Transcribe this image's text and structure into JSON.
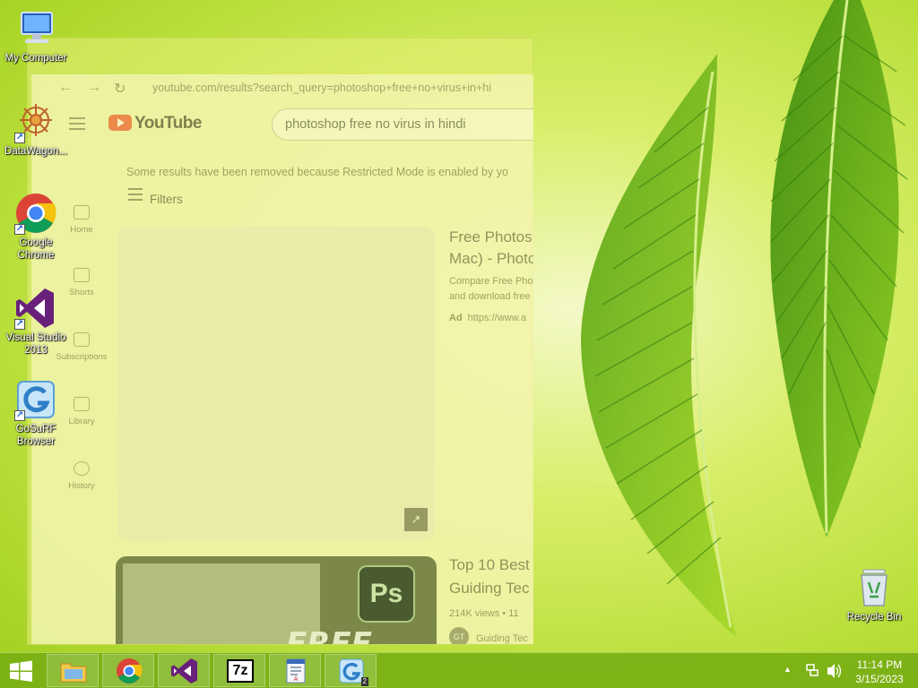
{
  "desktop": {
    "icons": [
      {
        "label": "My Computer"
      },
      {
        "label": "DataWagon..."
      },
      {
        "label": "Google Chrome"
      },
      {
        "label": "Visual Studio 2013"
      },
      {
        "label": "GoSuRF Browser"
      }
    ],
    "recycle_bin": {
      "label": "Recycle Bin"
    }
  },
  "browser": {
    "url": "youtube.com/results?search_query=photoshop+free+no+virus+in+hi",
    "logo": "YouTube",
    "search_value": "photoshop free no virus in hindi",
    "notice": "Some results have been removed because Restricted Mode is enabled by yo",
    "filters_label": "Filters",
    "sidebar": [
      {
        "label": "Home"
      },
      {
        "label": "Shorts"
      },
      {
        "label": "Subscriptions"
      },
      {
        "label": "Library"
      },
      {
        "label": "History"
      }
    ],
    "results": [
      {
        "title_line1": "Free Photos",
        "title_line2": "Mac) - Photo",
        "desc_line1": "Compare Free Pho",
        "desc_line2": "and download free",
        "ad_label": "Ad",
        "ad_url": "https://www.a"
      },
      {
        "title_line1": "Top 10 Best",
        "title_line2": "Guiding Tec",
        "meta": "214K views • 11",
        "channel": "Guiding Tec",
        "channel_initials": "GT",
        "thumb_badge": "Ps",
        "thumb_text": "FREE"
      }
    ]
  },
  "taskbar": {
    "apps": [
      {
        "name": "File Explorer"
      },
      {
        "name": "Google Chrome"
      },
      {
        "name": "Visual Studio"
      },
      {
        "name": "7-Zip",
        "glyph": "7z"
      },
      {
        "name": "Document Viewer"
      },
      {
        "name": "GoSuRF Browser",
        "badge": "2"
      }
    ],
    "clock": {
      "time": "11:14 PM",
      "date": "3/15/2023"
    }
  },
  "colors": {
    "taskbar": "#7aaf14",
    "youtube_red": "#eb783c",
    "visual_studio_purple": "#68217a"
  }
}
